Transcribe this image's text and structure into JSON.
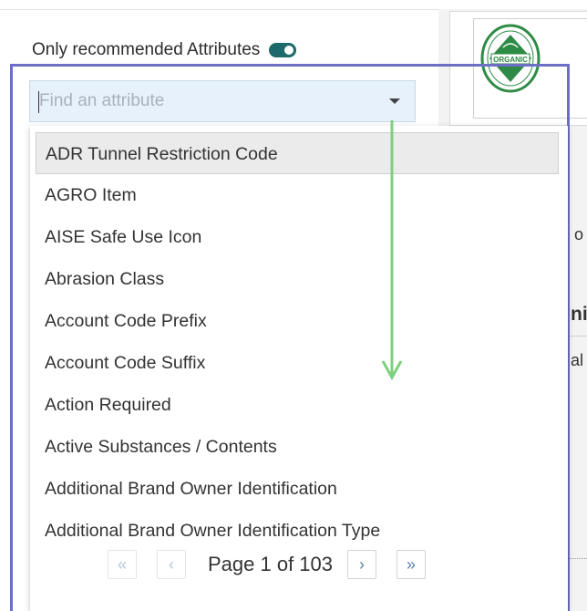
{
  "toggle": {
    "label": "Only recommended Attributes",
    "enabled": true
  },
  "search": {
    "placeholder": "Find an attribute",
    "value": ""
  },
  "dropdown": {
    "selected_index": 0,
    "items": [
      "ADR Tunnel Restriction Code",
      "AGRO Item",
      "AISE Safe Use Icon",
      "Abrasion Class",
      "Account Code Prefix",
      "Account Code Suffix",
      "Action Required",
      "Active Substances / Contents",
      "Additional Brand Owner Identification",
      "Additional Brand Owner Identification Type"
    ]
  },
  "pager": {
    "first": "«",
    "prev": "‹",
    "label": "Page 1 of 103",
    "next": "›",
    "last": "»"
  },
  "background": {
    "partial_texts": [
      "o",
      "ni",
      "al"
    ]
  },
  "colors": {
    "accent": "#6c6fc4",
    "toggle": "#1c6a6a",
    "search_bg": "#e6f1fb",
    "arrow": "#7ed07e",
    "seal_green": "#2e8b45"
  },
  "icons": [
    "chevron-down-icon",
    "double-chevron-left-icon",
    "chevron-left-icon",
    "chevron-right-icon",
    "double-chevron-right-icon",
    "organic-seal-icon",
    "down-arrow-icon"
  ]
}
